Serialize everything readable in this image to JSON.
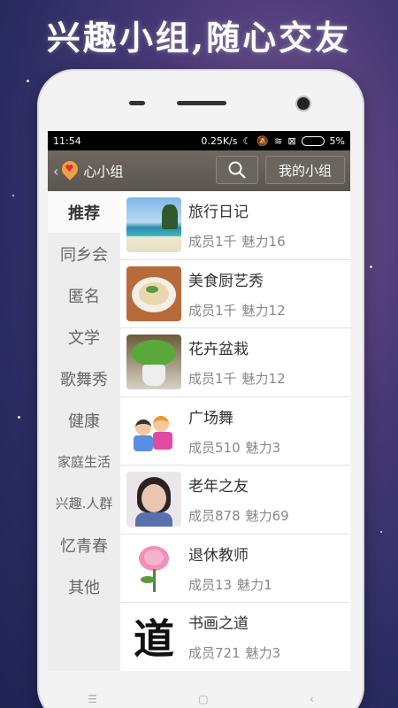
{
  "headline": "兴趣小组,随心交友",
  "status": {
    "time": "11:54",
    "speed": "0.25K/s",
    "battery": "5%"
  },
  "appbar": {
    "back": "‹",
    "title": "心小组",
    "my_group_label": "我的小组"
  },
  "categories": [
    "推荐",
    "同乡会",
    "匿名",
    "文学",
    "歌舞秀",
    "健康",
    "家庭生活",
    "兴趣.人群",
    "忆青春",
    "其他"
  ],
  "groups": [
    {
      "name": "旅行日记",
      "members": "成员1千",
      "charm": "魅力16",
      "thumb": "beach-photo"
    },
    {
      "name": "美食厨艺秀",
      "members": "成员1千",
      "charm": "魅力12",
      "thumb": "food-photo"
    },
    {
      "name": "花卉盆栽",
      "members": "成员1千",
      "charm": "魅力12",
      "thumb": "plant-photo"
    },
    {
      "name": "广场舞",
      "members": "成员510",
      "charm": "魅力3",
      "thumb": "dance-cartoon"
    },
    {
      "name": "老年之友",
      "members": "成员878",
      "charm": "魅力69",
      "thumb": "woman-portrait"
    },
    {
      "name": "退休教师",
      "members": "成员13",
      "charm": "魅力1",
      "thumb": "peony-flower"
    },
    {
      "name": "书画之道",
      "members": "成员721",
      "charm": "魅力3",
      "thumb": "calligraphy"
    }
  ],
  "thumb_calligraphy_char": "道",
  "colors": {
    "appbar": "#5f5a54",
    "background": "#3a3670",
    "accent_pin": "#f0a040"
  }
}
